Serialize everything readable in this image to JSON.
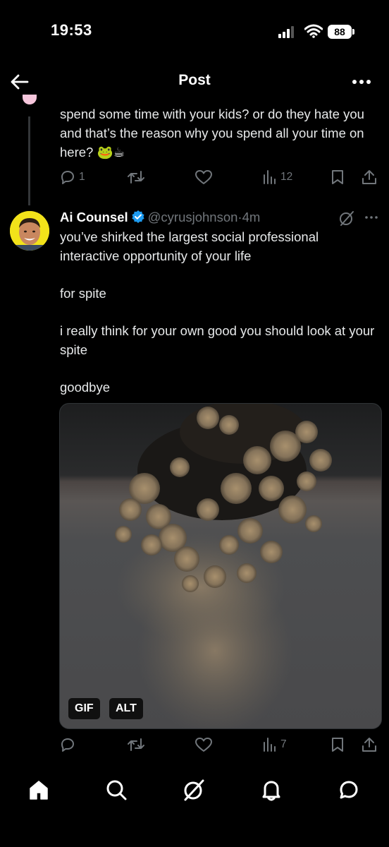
{
  "status_bar": {
    "time": "19:53",
    "battery": "88"
  },
  "header": {
    "title": "Post"
  },
  "previous_post": {
    "text": "spend some time with your kids? or do they hate you and that’s the reason why you spend all your time on here? 🐸☕",
    "replies": "1",
    "reposts": "",
    "likes": "",
    "views": "12"
  },
  "post": {
    "author_name": "Ai Counsel",
    "handle": "@cyrusjohnson",
    "separator": "·",
    "time": "4m",
    "paragraphs": [
      "you’ve shirked the largest social professional interactive opportunity of your life",
      "for spite",
      "i really think for your own good you should look at your spite",
      "goodbye"
    ],
    "media_badges": {
      "gif": "GIF",
      "alt": "ALT"
    },
    "views": "7"
  },
  "icons": {
    "back": "arrow-left-icon",
    "more": "more-horizontal-icon",
    "reply": "reply-icon",
    "repost": "repost-icon",
    "like": "heart-icon",
    "views": "views-chart-icon",
    "bookmark": "bookmark-icon",
    "share": "share-icon",
    "grok": "grok-icon",
    "verified": "verified-badge-icon"
  },
  "colors": {
    "background": "#000000",
    "text": "#e7e9ea",
    "muted": "#71767b",
    "verified": "#1d9bf0",
    "avatar_bg": "#f2e21a"
  }
}
